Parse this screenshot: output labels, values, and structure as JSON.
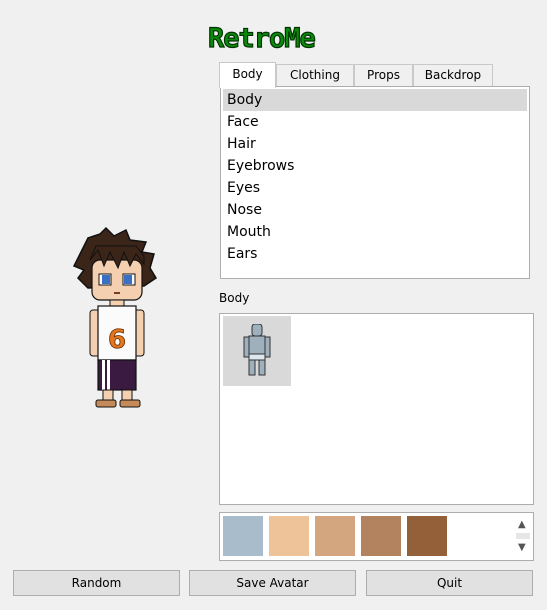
{
  "logo": {
    "text": "RetroMe"
  },
  "avatar": {
    "shirt_number": "6"
  },
  "tabs": [
    {
      "label": "Body",
      "active": true
    },
    {
      "label": "Clothing",
      "active": false
    },
    {
      "label": "Props",
      "active": false
    },
    {
      "label": "Backdrop",
      "active": false
    }
  ],
  "categories": {
    "selected_index": 0,
    "items": [
      "Body",
      "Face",
      "Hair",
      "Eyebrows",
      "Eyes",
      "Nose",
      "Mouth",
      "Ears"
    ]
  },
  "section": {
    "label": "Body"
  },
  "swatches": {
    "colors": [
      "#a9bccb",
      "#eec39a",
      "#d4a680",
      "#b38360",
      "#94603a"
    ]
  },
  "buttons": {
    "random": "Random",
    "save": "Save Avatar",
    "quit": "Quit"
  }
}
